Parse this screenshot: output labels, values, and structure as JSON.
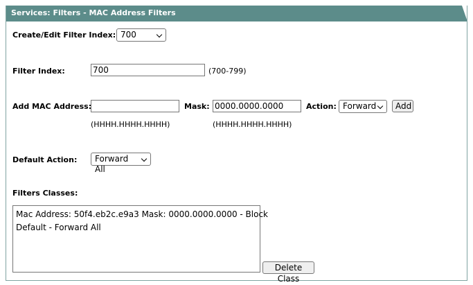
{
  "header": {
    "title": "Services: Filters - MAC Address Filters"
  },
  "filter_index_select": {
    "label": "Create/Edit Filter Index:",
    "value": "700"
  },
  "filter_index": {
    "label": "Filter Index:",
    "value": "700",
    "range_hint": "(700-799)"
  },
  "add_mac": {
    "label": "Add MAC Address:",
    "mac_value": "",
    "mac_hint": "(HHHH.HHHH.HHHH)",
    "mask_label": "Mask:",
    "mask_value": "0000.0000.0000",
    "mask_hint": "(HHHH.HHHH.HHHH)",
    "action_label": "Action:",
    "action_value": "Forward",
    "add_button": "Add"
  },
  "default_action": {
    "label": "Default Action:",
    "value": "Forward All"
  },
  "filter_classes": {
    "label": "Filters Classes:",
    "items": [
      "Mac Address: 50f4.eb2c.e9a3 Mask: 0000.0000.0000 - Block",
      "Default - Forward All"
    ],
    "delete_button": "Delete Class"
  }
}
